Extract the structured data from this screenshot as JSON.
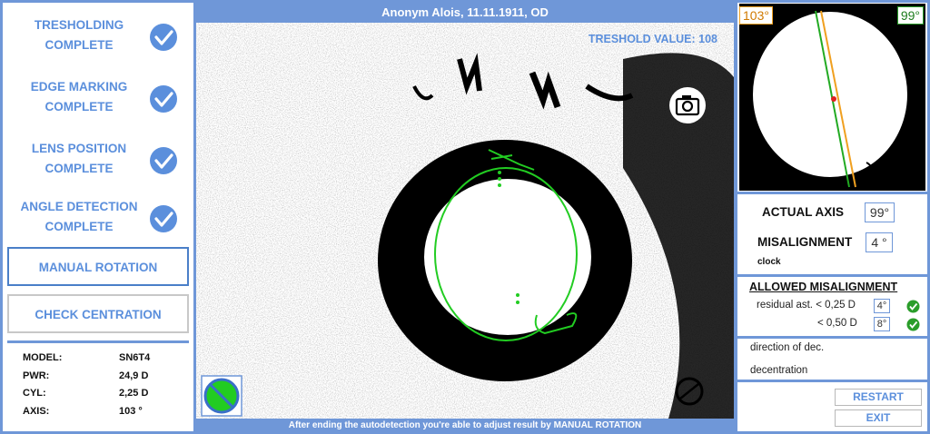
{
  "header": {
    "patient": "Anonym Alois, 11.11.1911, OD"
  },
  "steps": [
    {
      "line1": "TRESHOLDING",
      "line2": "COMPLETE"
    },
    {
      "line1": "EDGE MARKING",
      "line2": "COMPLETE"
    },
    {
      "line1": "LENS POSITION",
      "line2": "COMPLETE"
    },
    {
      "line1": "ANGLE DETECTION",
      "line2": "COMPLETE"
    }
  ],
  "buttons": {
    "manual_rotation": "MANUAL ROTATION",
    "check_centration": "CHECK CENTRATION",
    "restart": "RESTART",
    "exit": "EXIT"
  },
  "lens_info": [
    {
      "key": "MODEL:",
      "value": "SN6T4"
    },
    {
      "key": "PWR:",
      "value": "24,9 D"
    },
    {
      "key": "CYL:",
      "value": "2,25 D"
    },
    {
      "key": "AXIS:",
      "value": "103 °"
    }
  ],
  "viewer": {
    "threshold_label": "TRESHOLD VALUE: 108",
    "footer_hint": "After ending the autodetection you're able to adjust result by MANUAL ROTATION"
  },
  "thumbnail": {
    "angle_left": "103°",
    "angle_right": "99°"
  },
  "results": {
    "actual_axis_label": "ACTUAL AXIS",
    "actual_axis_value": "99°",
    "misalignment_label": "MISALIGNMENT",
    "misalignment_value": "4 °",
    "misalignment_dir": "clock"
  },
  "allowed": {
    "title": "ALLOWED MISALIGNMENT",
    "rows": [
      {
        "label": "residual ast. < 0,25 D",
        "value": "4°"
      },
      {
        "label": "< 0,50 D",
        "value": "8°"
      }
    ]
  },
  "decentration": {
    "direction_label": "direction of dec.",
    "label": "decentration"
  },
  "colors": {
    "accent": "#5b8fdc",
    "frame": "#6f97d8",
    "detected": "#22cc22",
    "ok": "#2a9d2a",
    "axis_old": "#f0a020"
  }
}
